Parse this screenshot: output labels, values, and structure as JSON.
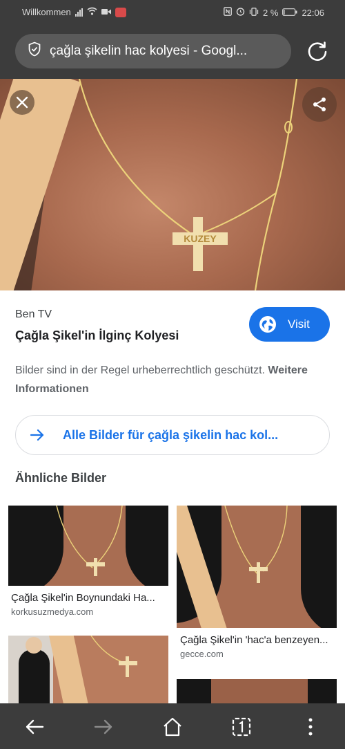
{
  "status_bar": {
    "carrier": "Willkommen",
    "battery": "2 %",
    "time": "22:06"
  },
  "browser": {
    "url_text": "çağla şikelin hac kolyesi - Googl..."
  },
  "image_result": {
    "source": "Ben TV",
    "title": "Çağla Şikel'in İlginç Kolyesi",
    "visit_label": "Visit",
    "notice": "Bilder sind in der Regel urheberrechtlich geschützt.",
    "notice_link": "Weitere Informationen",
    "all_images_label": "Alle Bilder für çağla şikelin hac kol...",
    "pendant_text": "KUZEY"
  },
  "similar": {
    "heading": "Ähnliche Bilder",
    "items": [
      {
        "title": "Çağla Şikel'in Boynundaki Ha...",
        "domain": "korkusuzmedya.com"
      },
      {
        "title": "Çağla Şikel'in 'hac'a benzeyen...",
        "domain": "gecce.com"
      }
    ]
  },
  "colors": {
    "accent": "#1a73e8",
    "bar": "#3c3c3c"
  }
}
